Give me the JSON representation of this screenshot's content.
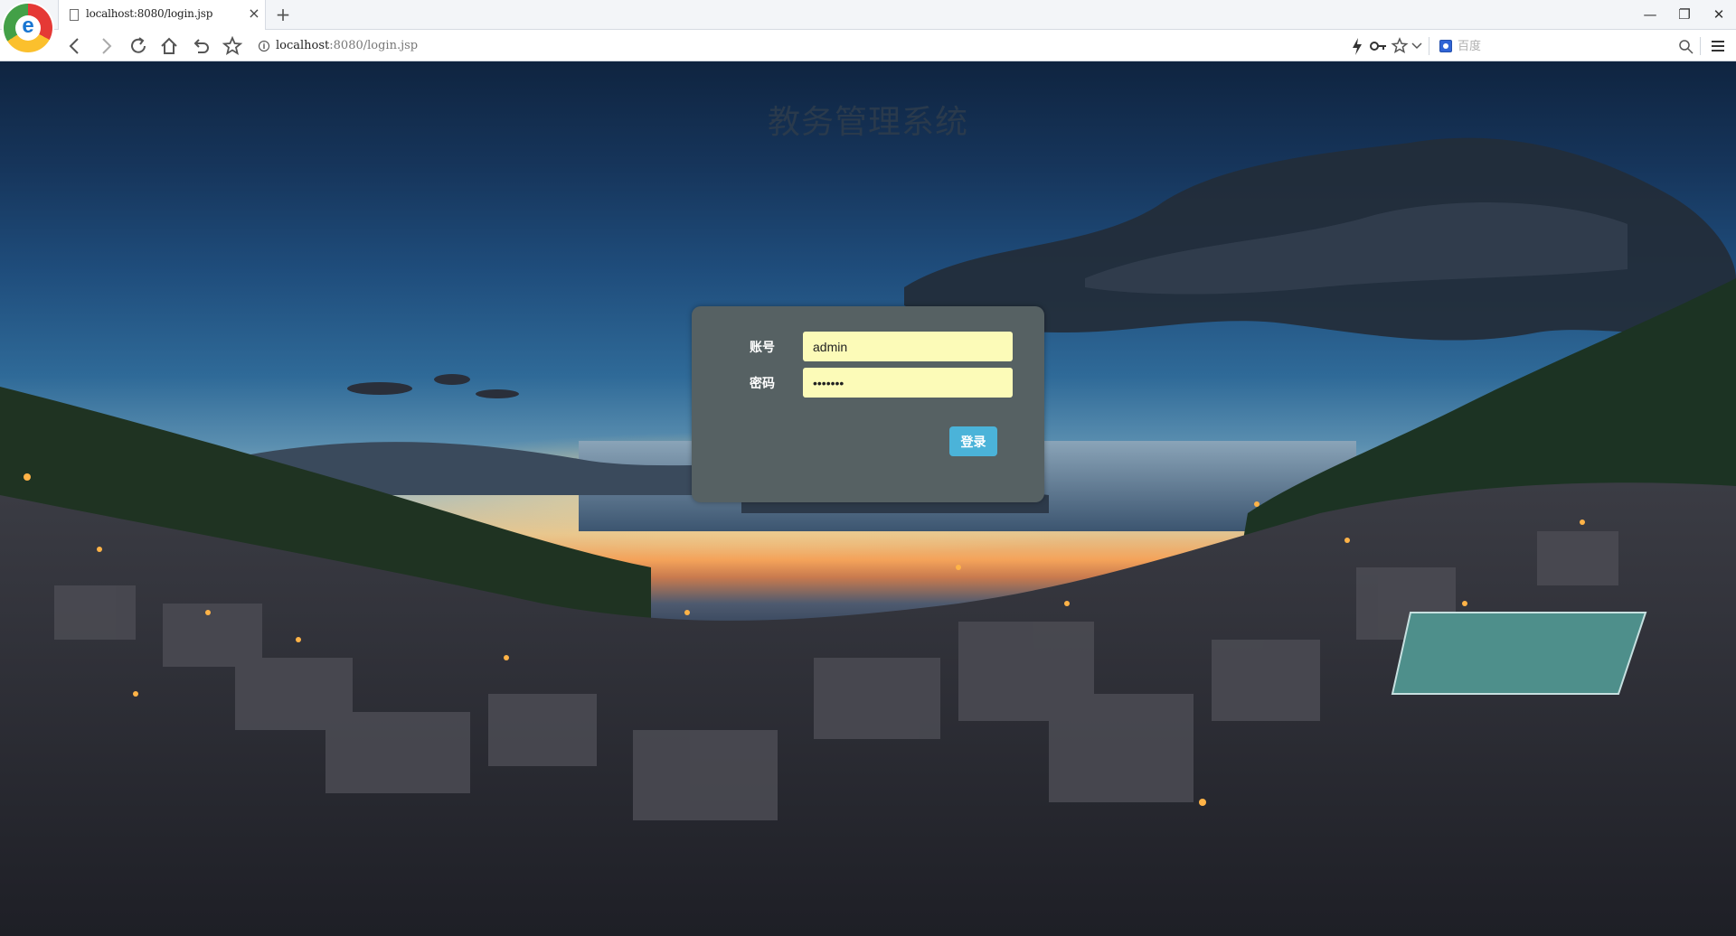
{
  "browser": {
    "tab_title": "localhost:8080/login.jsp",
    "tab_close": "×",
    "new_tab": "+",
    "address_host": "localhost",
    "address_rest": ":8080/login.jsp",
    "search_placeholder": "百度",
    "window": {
      "minimize": "—",
      "restore": "❐",
      "close": "✕"
    },
    "icons": {
      "back": "back-icon",
      "forward": "forward-icon",
      "reload": "reload-icon",
      "home": "home-icon",
      "undo": "undo-closed-tab-icon",
      "favorites": "star-icon",
      "site_info": "info-icon",
      "speed": "lightning-icon",
      "key": "key-icon",
      "bookmark": "star-outline-icon",
      "dropdown": "chevron-down-icon",
      "search": "search-icon",
      "menu": "hamburger-menu-icon"
    }
  },
  "page": {
    "title": "教务管理系统",
    "login": {
      "account_label": "账号",
      "account_value": "admin",
      "password_label": "密码",
      "password_value": "•••••••",
      "submit_label": "登录"
    }
  },
  "colors": {
    "panel_bg": "#566163",
    "input_bg": "#fcfbb8",
    "button_bg": "#4bb3d9",
    "title_color": "#2a3a4c"
  }
}
